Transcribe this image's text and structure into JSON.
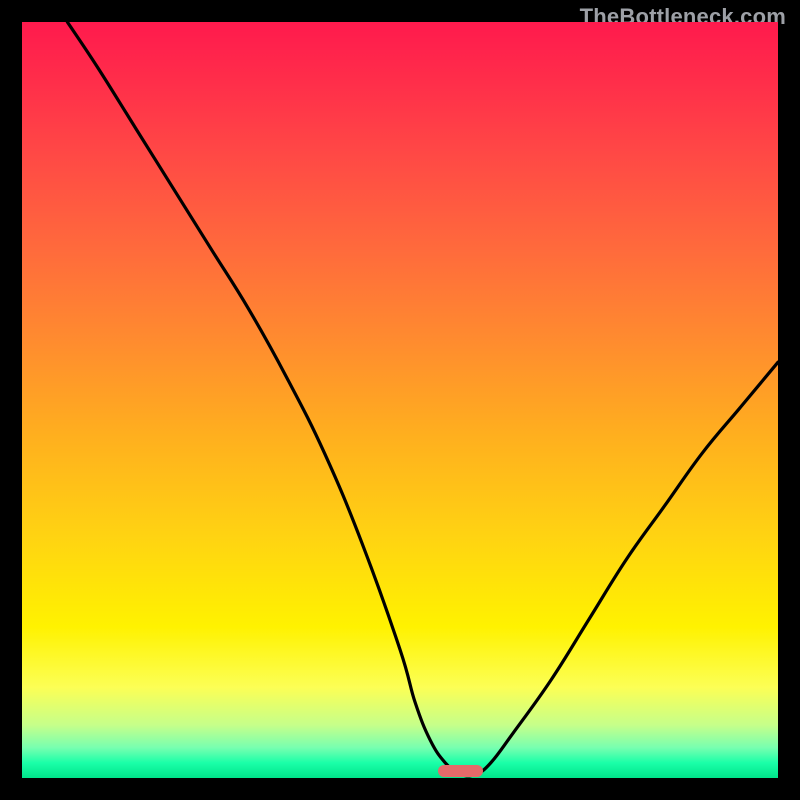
{
  "watermark": {
    "text": "TheBottleneck.com"
  },
  "chart_data": {
    "type": "line",
    "title": "",
    "xlabel": "",
    "ylabel": "",
    "xlim": [
      0,
      100
    ],
    "ylim": [
      0,
      100
    ],
    "grid": false,
    "background": "red-yellow-green vertical gradient",
    "series": [
      {
        "name": "bottleneck-curve",
        "x": [
          6,
          10,
          15,
          20,
          25,
          30,
          35,
          40,
          45,
          50,
          52,
          54,
          56,
          58,
          60,
          62,
          65,
          70,
          75,
          80,
          85,
          90,
          95,
          100
        ],
        "y": [
          100,
          94,
          86,
          78,
          70,
          62,
          53,
          43,
          31,
          17,
          10,
          5,
          2,
          0.5,
          0.5,
          2,
          6,
          13,
          21,
          29,
          36,
          43,
          49,
          55
        ]
      }
    ],
    "marker": {
      "x_center": 58,
      "width_pct": 6,
      "y": 0,
      "color": "#e46a6a"
    }
  },
  "colors": {
    "frame": "#000000",
    "marker": "#e46a6a",
    "watermark": "#9da0a6"
  }
}
